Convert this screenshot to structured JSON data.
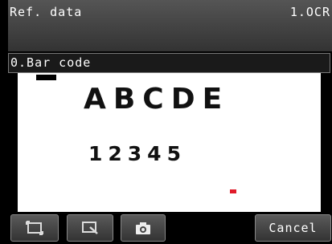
{
  "header": {
    "title": "Ref. data",
    "mode": "1.OCR"
  },
  "subtitle": {
    "label": "0.Bar code"
  },
  "image": {
    "line1": "ABCDE",
    "line2": "12345"
  },
  "toolbar": {
    "icons": [
      "frame-icon",
      "zoom-window-icon",
      "camera-icon"
    ],
    "cancel_label": "Cancel"
  },
  "colors": {
    "header_bg": "#444444",
    "marker_red": "#e01b2a",
    "image_bg": "#ffffff"
  }
}
